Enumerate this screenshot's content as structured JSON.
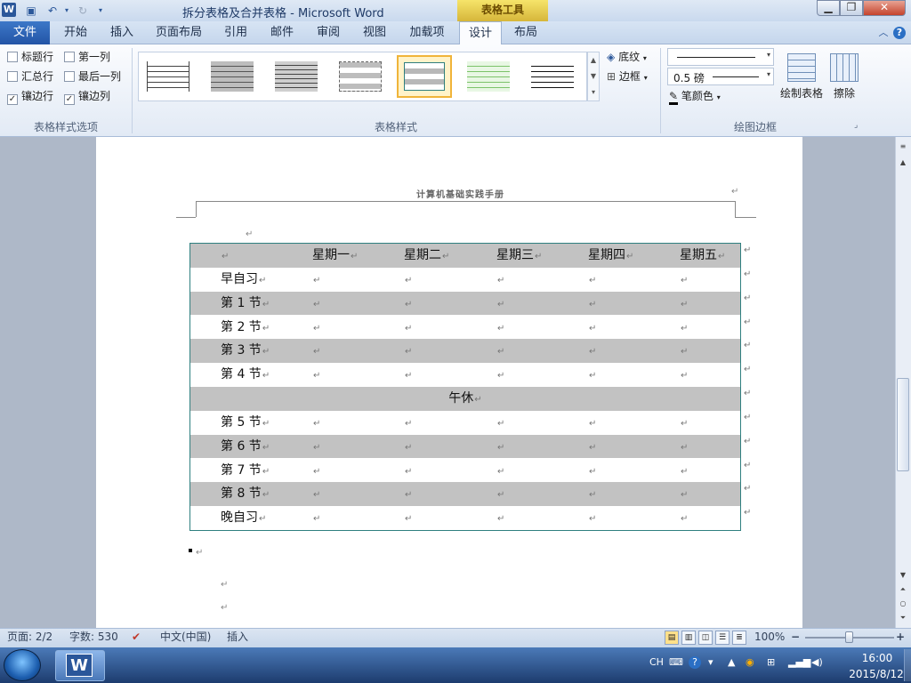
{
  "window": {
    "title": "拆分表格及合并表格 - Microsoft Word",
    "app_icon": "W",
    "context_group": "表格工具",
    "min": "▁",
    "max": "❐",
    "close": "✕"
  },
  "tabs": {
    "file": "文件",
    "items": [
      "开始",
      "插入",
      "页面布局",
      "引用",
      "邮件",
      "审阅",
      "视图",
      "加载项",
      "设计",
      "布局"
    ]
  },
  "ribbon": {
    "style_options": {
      "label": "表格样式选项",
      "items": [
        {
          "label": "标题行",
          "checked": false
        },
        {
          "label": "第一列",
          "checked": false
        },
        {
          "label": "汇总行",
          "checked": false
        },
        {
          "label": "最后一列",
          "checked": false
        },
        {
          "label": "镶边行",
          "checked": true
        },
        {
          "label": "镶边列",
          "checked": true
        }
      ],
      "check_mark": "✓"
    },
    "table_styles": {
      "label": "表格样式"
    },
    "shading": "底纹",
    "borders": "边框",
    "draw_borders": {
      "label": "绘图边框",
      "line_weight": "0.5 磅",
      "pen_color": "笔颜色",
      "draw_table": "绘制表格",
      "eraser": "擦除"
    }
  },
  "document": {
    "header_text": "计算机基础实践手册",
    "para_mark": "↵",
    "table": {
      "header_row": [
        "",
        "星期一",
        "星期二",
        "星期三",
        "星期四",
        "星期五"
      ],
      "rows": [
        [
          "早自习",
          "",
          "",
          "",
          "",
          ""
        ],
        [
          "第 1 节",
          "",
          "",
          "",
          "",
          ""
        ],
        [
          "第 2 节",
          "",
          "",
          "",
          "",
          ""
        ],
        [
          "第 3 节",
          "",
          "",
          "",
          "",
          ""
        ],
        [
          "第 4 节",
          "",
          "",
          "",
          "",
          ""
        ],
        [
          "午休"
        ],
        [
          "第 5 节",
          "",
          "",
          "",
          "",
          ""
        ],
        [
          "第 6 节",
          "",
          "",
          "",
          "",
          ""
        ],
        [
          "第 7 节",
          "",
          "",
          "",
          "",
          ""
        ],
        [
          "第 8 节",
          "",
          "",
          "",
          "",
          ""
        ],
        [
          "晚自习",
          "",
          "",
          "",
          "",
          ""
        ]
      ]
    }
  },
  "status": {
    "page": "页面: 2/2",
    "words": "字数: 530",
    "language": "中文(中国)",
    "mode": "插入",
    "zoom": "100%",
    "zoom_minus": "−",
    "zoom_plus": "+"
  },
  "taskbar": {
    "word_icon": "W",
    "ime": "CH",
    "time": "16:00",
    "date": "2015/8/12"
  }
}
